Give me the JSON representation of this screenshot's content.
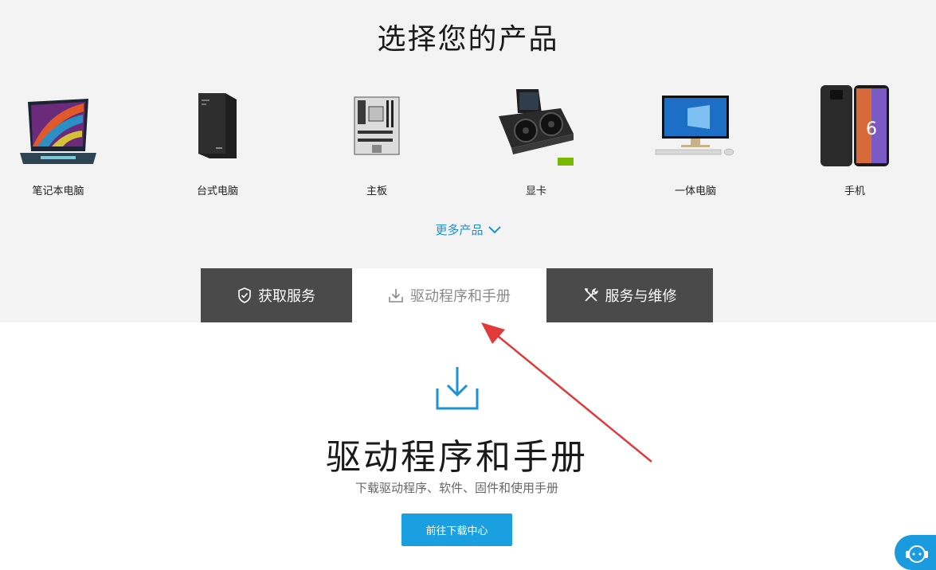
{
  "page": {
    "title": "选择您的产品"
  },
  "products": [
    {
      "label": "笔记本电脑",
      "icon": "laptop-icon"
    },
    {
      "label": "台式电脑",
      "icon": "desktop-tower-icon"
    },
    {
      "label": "主板",
      "icon": "motherboard-icon"
    },
    {
      "label": "显卡",
      "icon": "graphics-card-icon"
    },
    {
      "label": "一体电脑",
      "icon": "all-in-one-pc-icon"
    },
    {
      "label": "手机",
      "icon": "phone-icon"
    }
  ],
  "more_products": {
    "label": "更多产品",
    "icon": "chevron-down-icon"
  },
  "tabs": [
    {
      "label": "获取服务",
      "icon": "shield-check-icon",
      "active": false
    },
    {
      "label": "驱动程序和手册",
      "icon": "download-icon",
      "active": true
    },
    {
      "label": "服务与维修",
      "icon": "tools-icon",
      "active": false
    }
  ],
  "hero": {
    "icon": "download-icon",
    "title": "驱动程序和手册",
    "subtitle": "下载驱动程序、软件、固件和使用手册",
    "button_label": "前往下载中心"
  },
  "chat": {
    "icon": "customer-service-icon"
  },
  "colors": {
    "accent": "#1aa0e0",
    "tab_dark": "#4a4a4a",
    "top_background": "#f3f3f3",
    "annotation_arrow": "#e03a3a"
  }
}
